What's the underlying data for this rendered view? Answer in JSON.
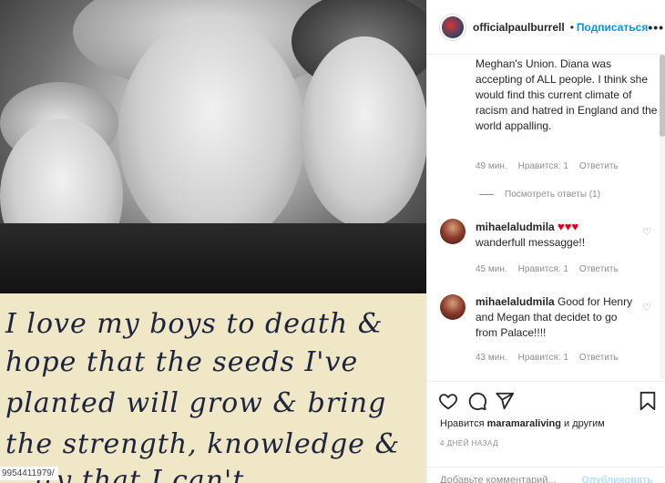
{
  "photo": {
    "handwriting": [
      "I love my boys to death &",
      "hope that the seeds I've",
      "planted will grow & bring",
      "the strength, knowledge &",
      "...ity that I can't..."
    ],
    "id_label": "9954411979/"
  },
  "header": {
    "username": "officialpaulburrell",
    "separator": "•",
    "follow_label": "Подписаться",
    "more_label": "•••"
  },
  "comments": {
    "first": {
      "text": "Meghan's Union. Diana was accepting of ALL people. I think she would find this current climate of racism and hatred in England and the world appalling.",
      "time": "49 мин.",
      "likes": "Нравится: 1",
      "reply": "Ответить",
      "view_replies": "Посмотреть ответы (1)"
    },
    "second": {
      "user": "mihaelaludmila",
      "hearts": "♥♥♥",
      "text": "wanderfull messagge!!",
      "time": "45 мин.",
      "likes": "Нравится: 1",
      "reply": "Ответить"
    },
    "third": {
      "user": "mihaelaludmila",
      "text": "Good for Henry and Megan that decidet to go from Palace!!!!",
      "time": "43 мин.",
      "likes": "Нравится: 1",
      "reply": "Ответить"
    }
  },
  "actions": {
    "likes_prefix": "Нравится",
    "likes_user": "maramaraliving",
    "likes_suffix": "и другим",
    "time": "4 ДНЕЙ НАЗАД"
  },
  "add_comment": {
    "placeholder": "Добавьте комментарий...",
    "publish": "Опубликовать"
  }
}
